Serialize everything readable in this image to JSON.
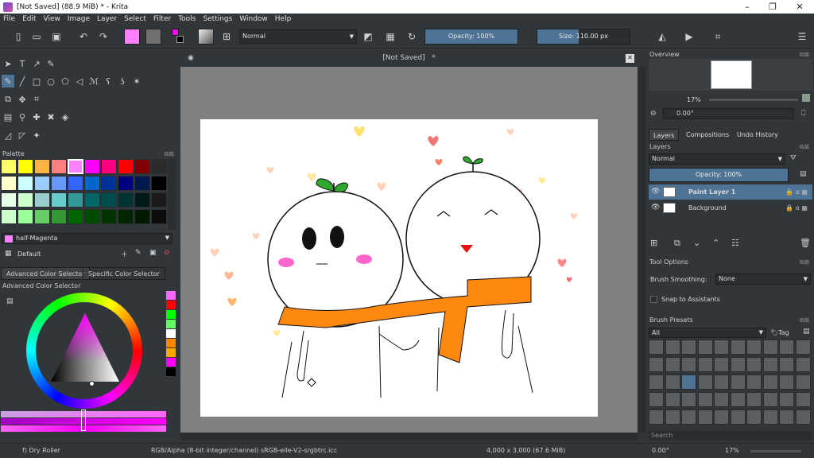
{
  "title": {
    "text": "[Not Saved]  (88.9 MiB)  * - Krita"
  },
  "menu": [
    "File",
    "Edit",
    "View",
    "Image",
    "Layer",
    "Select",
    "Filter",
    "Tools",
    "Settings",
    "Window",
    "Help"
  ],
  "toolbar": {
    "blend_mode": "Normal",
    "opacity": {
      "label": "Opacity: 100%",
      "value": 1.0
    },
    "size": {
      "label": "Size: 110.00 px",
      "value": 0.45
    }
  },
  "palette": {
    "header": "Palette",
    "colors": [
      "#ffff66",
      "#ffff00",
      "#ffb347",
      "#ff7f7f",
      "#ff80ff",
      "#ff00ff",
      "#ff0080",
      "#ff0000",
      "#800000",
      "#2b2b2b",
      "#ffffcc",
      "#ccffff",
      "#99ccff",
      "#6699ff",
      "#3366ff",
      "#0066cc",
      "#003399",
      "#000080",
      "#001a4d",
      "#000000",
      "#e6ffe6",
      "#ccffcc",
      "#99cccc",
      "#66cccc",
      "#339999",
      "#006666",
      "#004d4d",
      "#003333",
      "#001a1a",
      "#1a1a1a",
      "#ccffcc",
      "#99ff99",
      "#66cc66",
      "#339933",
      "#006600",
      "#004d00",
      "#003300",
      "#002600",
      "#001a00",
      "#0d0d0d"
    ],
    "selected_color_name": "half-Magenta",
    "palette_name": "Default"
  },
  "color_selector": {
    "tabs": [
      "Advanced Color Selector",
      "Specific Color Selector"
    ],
    "header": "Advanced Color Selector",
    "history": [
      "#ff66ff",
      "#ff0000",
      "#00ff00",
      "#66ff66",
      "#ffffff",
      "#ff8800",
      "#ffaa00",
      "#ff00ff",
      "#000000"
    ]
  },
  "document": {
    "tab_title": "[Not Saved]",
    "tab_mark": "*"
  },
  "status": {
    "brush": "f) Dry Roller",
    "color_space": "RGB/Alpha (8-bit integer/channel)  sRGB-elle-V2-srgbtrc.icc",
    "dimensions": "4,000 x 3,000 (67.6 MiB)",
    "rotation": "0.00°",
    "zoom": "17%"
  },
  "right": {
    "overview_header": "Overview",
    "overview_zoom": "17%",
    "overview_rotation": "0.00°",
    "tabs": [
      "Layers",
      "Compositions",
      "Undo History"
    ],
    "layers_header": "Layers",
    "layer_blend": "Normal",
    "layer_opacity": "Opacity:  100%",
    "layers": [
      {
        "name": "Paint Layer 1",
        "selected": true
      },
      {
        "name": "Background",
        "selected": false
      }
    ],
    "tool_options_header": "Tool Options",
    "brush_smoothing_label": "Brush Smoothing:",
    "brush_smoothing_value": "None",
    "snap_label": "Snap to Assistants",
    "presets_header": "Brush Presets",
    "presets_filter": "All",
    "presets_tag": "Tag",
    "search_placeholder": "Search"
  }
}
